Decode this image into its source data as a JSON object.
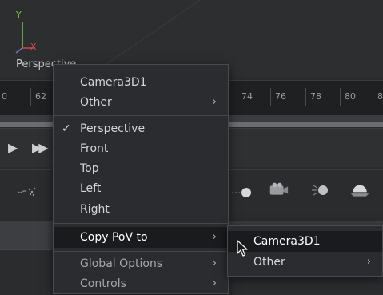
{
  "viewport": {
    "axes": {
      "y": "Y",
      "x": "X",
      "z": "Z"
    },
    "view_label": "Perspective"
  },
  "ruler": {
    "ticks": [
      "0",
      "62",
      "74",
      "76",
      "78",
      "80",
      "8"
    ]
  },
  "transport": {
    "buttons": [
      {
        "name": "play-icon",
        "glyph": "▶"
      },
      {
        "name": "fast-forward-icon",
        "glyph": "▶▶"
      }
    ]
  },
  "toolbar": {
    "icons": [
      "particles-icon",
      "point-light-icon",
      "camera-icon",
      "spotlight-icon",
      "ambient-light-icon"
    ]
  },
  "context_menu": {
    "items": [
      {
        "label": "Camera3D1",
        "submenu": false,
        "checked": false,
        "dim": false
      },
      {
        "label": "Other",
        "submenu": true,
        "checked": false,
        "dim": false
      },
      {
        "label": "Perspective",
        "submenu": false,
        "checked": true,
        "dim": false
      },
      {
        "label": "Front",
        "submenu": false,
        "checked": false,
        "dim": false
      },
      {
        "label": "Top",
        "submenu": false,
        "checked": false,
        "dim": false
      },
      {
        "label": "Left",
        "submenu": false,
        "checked": false,
        "dim": false
      },
      {
        "label": "Right",
        "submenu": false,
        "checked": false,
        "dim": false
      },
      {
        "label": "Copy PoV to",
        "submenu": true,
        "checked": false,
        "dim": false,
        "highlighted": true
      },
      {
        "label": "Global Options",
        "submenu": true,
        "checked": false,
        "dim": true
      },
      {
        "label": "Controls",
        "submenu": true,
        "checked": false,
        "dim": true
      }
    ],
    "check_glyph": "✓",
    "arrow_glyph": "›"
  },
  "submenu": {
    "items": [
      {
        "label": "Camera3D1",
        "submenu": false,
        "highlighted": true
      },
      {
        "label": "Other",
        "submenu": true,
        "highlighted": false
      }
    ]
  },
  "colors": {
    "menu_bg": "#2b2c2f",
    "highlight_bg": "#1a1b1d",
    "axis_y": "#6fcf3c",
    "axis_x": "#dd4444",
    "axis_z": "#6a79e0"
  }
}
